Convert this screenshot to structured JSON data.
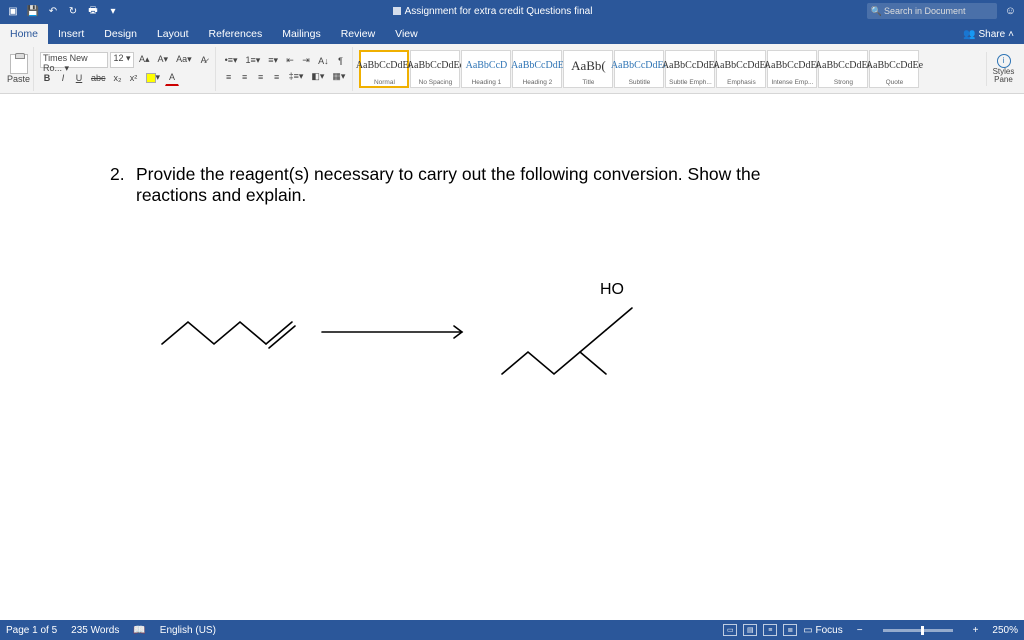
{
  "titlebar": {
    "doc_title": "Assignment for extra credit Questions final",
    "search_placeholder": "Search in Document"
  },
  "tabs": {
    "items": [
      "Home",
      "Insert",
      "Design",
      "Layout",
      "References",
      "Mailings",
      "Review",
      "View"
    ],
    "active": "Home",
    "share": "Share"
  },
  "ribbon": {
    "paste": "Paste",
    "font_name": "Times New Ro...",
    "font_size": "12",
    "grow": "A▴",
    "shrink": "A▾",
    "clear": "A",
    "bold": "B",
    "italic": "I",
    "underline": "U",
    "strike": "abc",
    "sub": "x₂",
    "sup": "x²",
    "highlight": "",
    "fontcolor": "A",
    "bullets": "≣",
    "numbers": "≣",
    "multilist": "≣",
    "indent_dec": "≡",
    "indent_inc": "≡",
    "sort": "A↓",
    "showmarks": "¶",
    "align_l": "≡",
    "align_c": "≡",
    "align_r": "≡",
    "align_j": "≡",
    "linespace": "‡≡",
    "shading": "◧",
    "borders": "▦",
    "styles": [
      {
        "preview": "AaBbCcDdEe",
        "name": "Normal",
        "class": "sel"
      },
      {
        "preview": "AaBbCcDdEe",
        "name": "No Spacing",
        "class": ""
      },
      {
        "preview": "AaBbCcD",
        "name": "Heading 1",
        "class": "heading"
      },
      {
        "preview": "AaBbCcDdE",
        "name": "Heading 2",
        "class": "heading"
      },
      {
        "preview": "AaBb(",
        "name": "Title",
        "class": "title"
      },
      {
        "preview": "AaBbCcDdEe",
        "name": "Subtitle",
        "class": "heading"
      },
      {
        "preview": "AaBbCcDdEe",
        "name": "Subtle Emph...",
        "class": ""
      },
      {
        "preview": "AaBbCcDdEe",
        "name": "Emphasis",
        "class": ""
      },
      {
        "preview": "AaBbCcDdEe",
        "name": "Intense Emp...",
        "class": ""
      },
      {
        "preview": "AaBbCcDdEe",
        "name": "Strong",
        "class": ""
      },
      {
        "preview": "AaBbCcDdEe",
        "name": "Quote",
        "class": ""
      }
    ],
    "styles_pane": "Styles\nPane"
  },
  "document": {
    "question_number": "2.",
    "question_line1": "Provide the reagent(s) necessary to carry out the following conversion. Show the",
    "question_line2": "reactions and explain.",
    "label_ho": "HO"
  },
  "status": {
    "page": "Page 1 of 5",
    "words": "235 Words",
    "lang": "English (US)",
    "focus": "Focus",
    "zoom": "250%"
  }
}
